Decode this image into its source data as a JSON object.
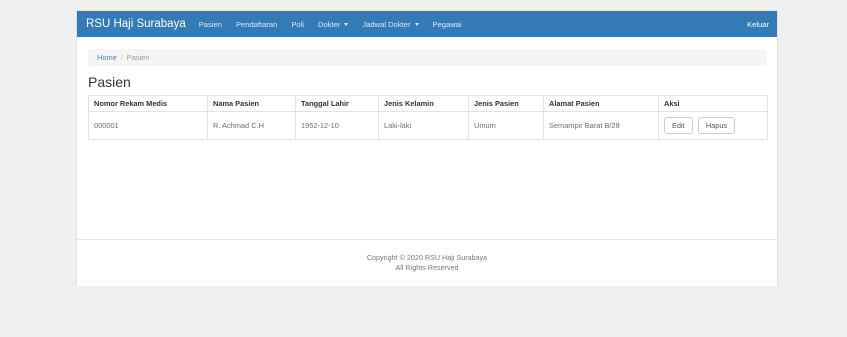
{
  "navbar": {
    "brand": "RSU Haji Surabaya",
    "items": [
      {
        "label": "Pasien"
      },
      {
        "label": "Pendaftaran"
      },
      {
        "label": "Poli"
      },
      {
        "label": "Dokter"
      },
      {
        "label": "Jadwal Dokter"
      },
      {
        "label": "Pegawai"
      }
    ],
    "logout": "Keluar",
    "color": "#337ab7"
  },
  "breadcrumb": {
    "home": "Home",
    "separator": "/",
    "current": "Pasien"
  },
  "page_title": "Pasien",
  "table": {
    "headers": [
      "Nomor Rekam Medis",
      "Nama Pasien",
      "Tanggal Lahir",
      "Jenis Kelamin",
      "Jenis Pasien",
      "Alamat Pasien",
      "Aksi"
    ],
    "rows": [
      {
        "cells": [
          "000001",
          "R. Achmad C.H",
          "1952-12-10",
          "Laki-laki",
          "Umum",
          "Semampir Barat B/28"
        ],
        "actions": {
          "edit": "Edit",
          "delete": "Hapus"
        }
      }
    ]
  },
  "footer": {
    "copyright": "Copyright © 2020 RSU Haji Surabaya",
    "rights": "All Rights Reserved"
  }
}
